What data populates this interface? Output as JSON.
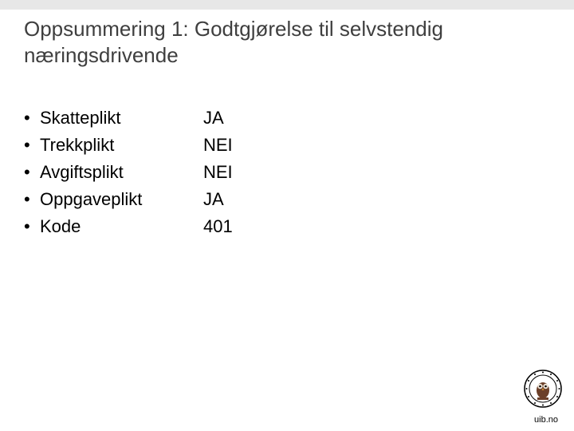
{
  "title": "Oppsummering 1: Godtgjørelse til selvstendig næringsdrivende",
  "rows": [
    {
      "label": "Skatteplikt",
      "value": "JA"
    },
    {
      "label": "Trekkplikt",
      "value": "NEI"
    },
    {
      "label": "Avgiftsplikt",
      "value": "NEI"
    },
    {
      "label": "Oppgaveplikt",
      "value": "JA"
    },
    {
      "label": "Kode",
      "value": "401"
    }
  ],
  "bullet": "•",
  "footer": {
    "url": "uib.no"
  }
}
